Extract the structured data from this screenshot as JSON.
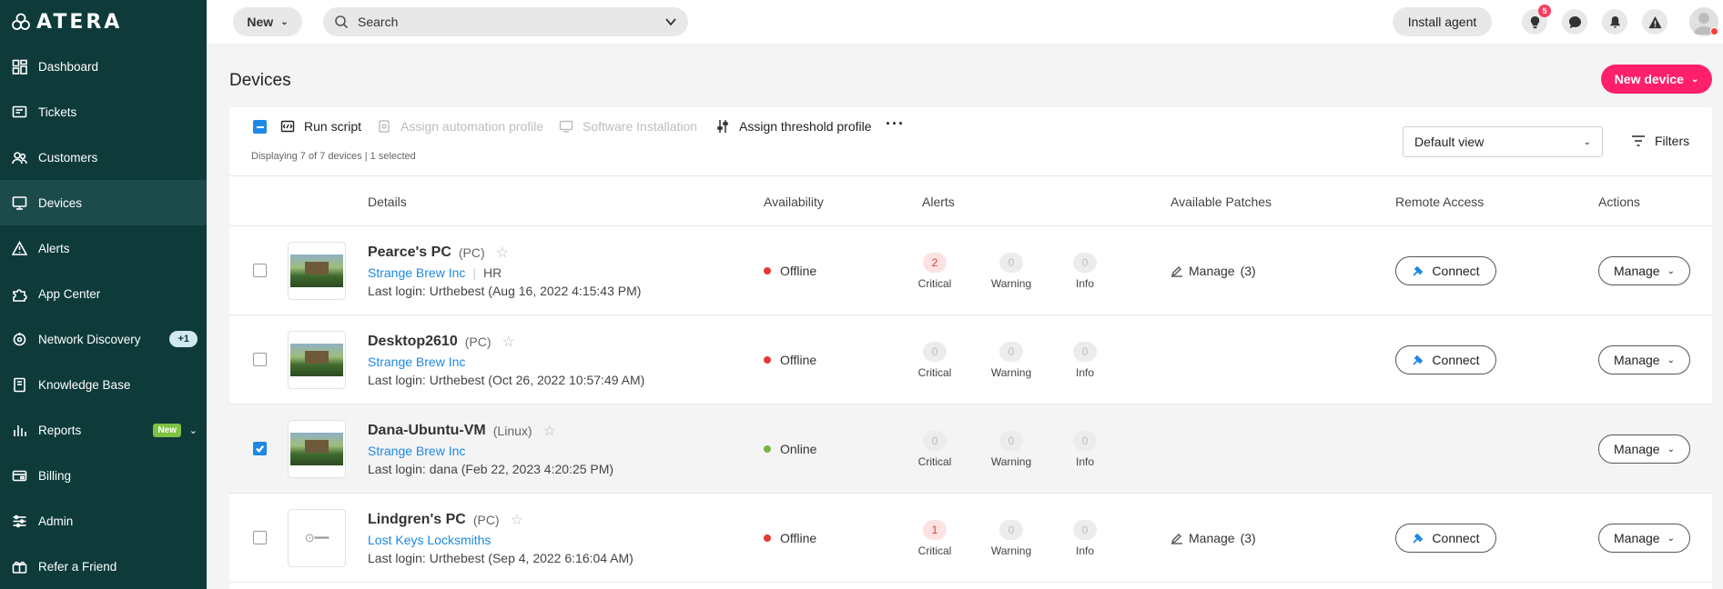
{
  "brand": {
    "name": "ATERA"
  },
  "sidebar": {
    "items": [
      {
        "label": "Dashboard",
        "icon": "dashboard-icon"
      },
      {
        "label": "Tickets",
        "icon": "tickets-icon"
      },
      {
        "label": "Customers",
        "icon": "customers-icon"
      },
      {
        "label": "Devices",
        "icon": "devices-icon",
        "active": true
      },
      {
        "label": "Alerts",
        "icon": "alerts-icon"
      },
      {
        "label": "App Center",
        "icon": "app-center-icon"
      },
      {
        "label": "Network Discovery",
        "icon": "network-discovery-icon",
        "badge": "+1"
      },
      {
        "label": "Knowledge Base",
        "icon": "knowledge-base-icon"
      },
      {
        "label": "Reports",
        "icon": "reports-icon",
        "badge": "New"
      },
      {
        "label": "Billing",
        "icon": "billing-icon"
      },
      {
        "label": "Admin",
        "icon": "admin-icon"
      },
      {
        "label": "Refer a Friend",
        "icon": "gift-icon"
      }
    ]
  },
  "topbar": {
    "new_label": "New",
    "search_placeholder": "Search",
    "install_agent_label": "Install agent",
    "notification_count": "5"
  },
  "page": {
    "title": "Devices",
    "new_device_label": "New device"
  },
  "toolbar": {
    "run_script": "Run script",
    "assign_automation_profile": "Assign automation profile",
    "software_installation": "Software Installation",
    "assign_threshold_profile": "Assign threshold profile",
    "more": "···",
    "display_text": "Displaying 7 of 7 devices | 1 selected",
    "view_select": "Default view",
    "filters_label": "Filters"
  },
  "table": {
    "headers": {
      "details": "Details",
      "availability": "Availability",
      "alerts": "Alerts",
      "patches": "Available Patches",
      "remote": "Remote Access",
      "actions": "Actions"
    },
    "alert_labels": {
      "critical": "Critical",
      "warning": "Warning",
      "info": "Info"
    },
    "connect_label": "Connect",
    "manage_label": "Manage",
    "patch_manage_label": "Manage",
    "rows": [
      {
        "name": "Pearce's PC",
        "os": "(PC)",
        "customer": "Strange Brew Inc",
        "tag": "HR",
        "login": "Last login: Urthebest (Aug 16, 2022 4:15:43 PM)",
        "status": "Offline",
        "status_color": "#e53935",
        "critical": "2",
        "warning": "0",
        "info": "0",
        "patches": "(3)",
        "has_connect": true,
        "selected": false,
        "thumb": "landscape"
      },
      {
        "name": "Desktop2610",
        "os": "(PC)",
        "customer": "Strange Brew Inc",
        "tag": "",
        "login": "Last login: Urthebest (Oct 26, 2022 10:57:49 AM)",
        "status": "Offline",
        "status_color": "#e53935",
        "critical": "0",
        "warning": "0",
        "info": "0",
        "patches": "",
        "has_connect": true,
        "selected": false,
        "thumb": "landscape"
      },
      {
        "name": "Dana-Ubuntu-VM",
        "os": "(Linux)",
        "customer": "Strange Brew Inc",
        "tag": "",
        "login": "Last login: dana (Feb 22, 2023 4:20:25 PM)",
        "status": "Online",
        "status_color": "#7cb342",
        "critical": "0",
        "warning": "0",
        "info": "0",
        "patches": "",
        "has_connect": false,
        "selected": true,
        "thumb": "landscape"
      },
      {
        "name": "Lindgren's PC",
        "os": "(PC)",
        "customer": "Lost Keys Locksmiths",
        "tag": "",
        "login": "Last login: Urthebest (Sep 4, 2022 6:16:04 AM)",
        "status": "Offline",
        "status_color": "#e53935",
        "critical": "1",
        "warning": "0",
        "info": "0",
        "patches": "(3)",
        "has_connect": true,
        "selected": false,
        "thumb": "key"
      }
    ]
  }
}
